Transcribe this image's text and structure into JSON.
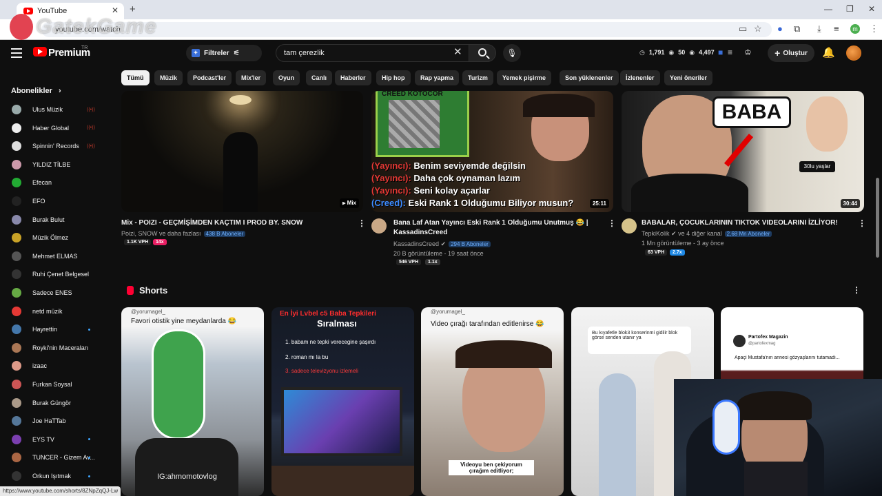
{
  "browser": {
    "tab_title": "YouTube",
    "url": "youtube.com/watch",
    "status_url": "https://www.youtube.com/shorts/8ZNpZqQJ-Lw",
    "watermark": "GatekGame"
  },
  "header": {
    "brand": "Premium",
    "region": "TR",
    "filter_label": "Filtreler",
    "search_query": "tam çerezlik",
    "stats": {
      "watch": "1,791",
      "views_a": "50",
      "views_b": "4,497"
    },
    "create_label": "Oluştur"
  },
  "sidebar": {
    "section_title": "Abonelikler",
    "items": [
      {
        "label": "Ulus Müzik",
        "color": "#9aa",
        "live": true
      },
      {
        "label": "Haber Global",
        "color": "#eee",
        "live": true
      },
      {
        "label": "Spinnin' Records",
        "color": "#ddd",
        "live": true
      },
      {
        "label": "YILDIZ TİLBE",
        "color": "#c9a"
      },
      {
        "label": "Efecan",
        "color": "#2a3"
      },
      {
        "label": "EFO",
        "color": "#222"
      },
      {
        "label": "Burak Bulut",
        "color": "#88a"
      },
      {
        "label": "Müzik Ölmez",
        "color": "#c9a227"
      },
      {
        "label": "Mehmet ELMAS",
        "color": "#555"
      },
      {
        "label": "Ruhi Çenet Belgesel",
        "color": "#333"
      },
      {
        "label": "Sadece ENES",
        "color": "#6a4"
      },
      {
        "label": "netd müzik",
        "color": "#e53935"
      },
      {
        "label": "Hayrettin",
        "color": "#47a",
        "dot": true
      },
      {
        "label": "Royki'nin Maceraları",
        "color": "#a75"
      },
      {
        "label": "izaac",
        "color": "#d98"
      },
      {
        "label": "Furkan Soysal",
        "color": "#c55"
      },
      {
        "label": "Burak Güngör",
        "color": "#a98"
      },
      {
        "label": "Joe HaTTab",
        "color": "#579"
      },
      {
        "label": "EYS TV",
        "color": "#7b3fb0",
        "dot": true
      },
      {
        "label": "TUNCER - Gizem Av...",
        "color": "#a64",
        "dot": true
      },
      {
        "label": "Orkun Işıtmak",
        "color": "#333",
        "dot": true
      }
    ]
  },
  "chips": [
    "Tümü",
    "Müzik",
    "Podcast'ler",
    "Mix'ler",
    "Oyun",
    "Canlı",
    "Haberler",
    "Hip hop",
    "Rap yapma",
    "Turizm",
    "Yemek pişirme",
    "Son yüklenenler",
    "İzlenenler",
    "Yeni öneriler"
  ],
  "videos": [
    {
      "title": "Mix - POIZI - GEÇMİŞİMDEN KAÇTIM I PROD BY. SNOW",
      "channel": "Poizi, SNOW ve daha fazlası",
      "subs": "438 B Aboneler",
      "badge": "Mix",
      "vph": "1.1K VPH",
      "mult": "14x",
      "mult_color": "#e91e63"
    },
    {
      "title": "Bana Laf Atan Yayıncı Eski Rank 1 Olduğumu Unutmuş 😂 | KassadinsCreed",
      "channel": "KassadinsCreed",
      "subs": "294 B Aboneler",
      "stats": "20 B görüntüleme - 19 saat önce",
      "badge": "25:11",
      "vph": "546 VPH",
      "mult": "1.1x",
      "mult_color": "#333333",
      "thumb_top": "CREED KOTOCOR",
      "overlay": [
        {
          "tag": "(Yayıncı):",
          "text": " Benim seviyemde değilsin"
        },
        {
          "tag": "(Yayıncı):",
          "text": " Daha çok oynaman lazım"
        },
        {
          "tag": "(Yayıncı):",
          "text": " Seni kolay açarlar"
        },
        {
          "tag": "(Creed):",
          "text": " Eski Rank 1 Olduğumu Biliyor musun?"
        }
      ]
    },
    {
      "title": "BABALAR, ÇOCUKLARININ TIKTOK VIDEOLARINI İZLİYOR!",
      "channel": "TepkiKolik",
      "channel_extra": "ve 4 diğer kanal",
      "subs": "2,68 Mn Aboneler",
      "stats": "1 Mn görüntüleme - 3 ay önce",
      "badge": "30:44",
      "vph": "63 VPH",
      "mult": "2.7x",
      "mult_color": "#1e88e5",
      "thumb_label": "BABA",
      "thumb_tag": "30lu yaşlar"
    }
  ],
  "shorts": {
    "title": "Shorts",
    "items": [
      {
        "handle": "@yorumagel_",
        "caption": "Favori otistik yine meydanlarda 😂",
        "bottom": "IG:ahmomotovlog"
      },
      {
        "title_line1": "En İyi Lvbel c5 Baba Tepkileri",
        "title_line2": "Sıralması",
        "ranks": [
          "babam ne tepki verecegine şaşırdı",
          "roman mı la bu",
          "sadece televizyonu izlemeli"
        ]
      },
      {
        "handle": "@yorumagel_",
        "caption": "Video çırağı tarafından editlenirse 😂",
        "bottom": "Videoyu ben çekiyorum çırağım editliyor;"
      },
      {
        "chat": "Bu kıyafetle blok3 konserinmi gidilir blok görse senden utanır ya"
      },
      {
        "brand": "Partofex Magazin",
        "handle": "@partofexmag",
        "caption": "Apaçi Mustafa'nın annesi gözyaşlarını tutamadı..."
      }
    ]
  }
}
